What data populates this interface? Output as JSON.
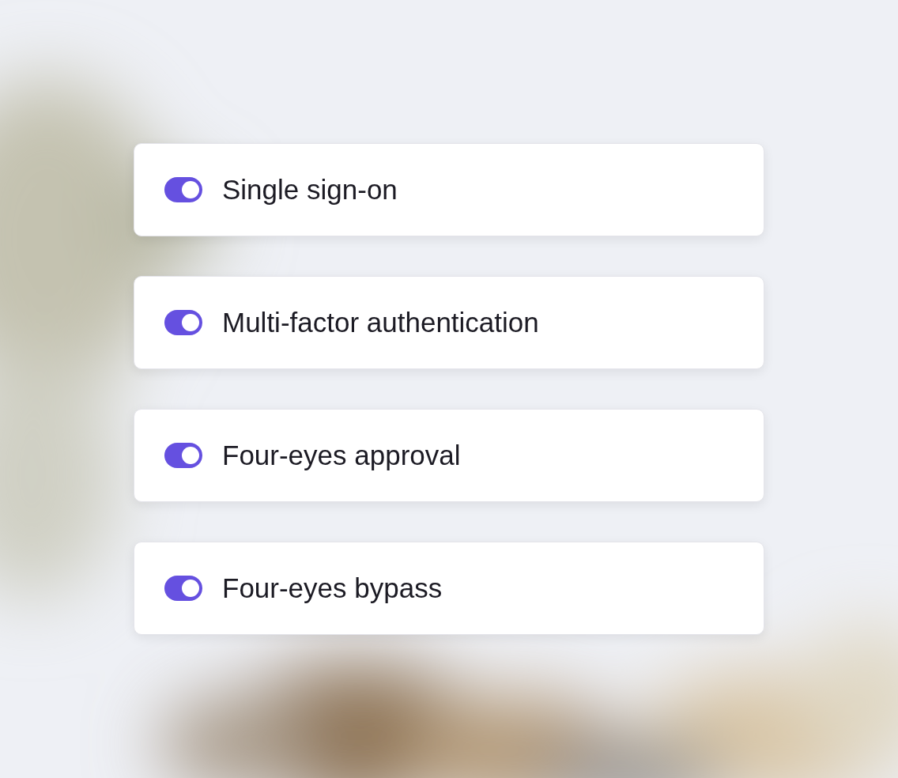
{
  "settings": [
    {
      "label": "Single sign-on",
      "on": true
    },
    {
      "label": "Multi-factor authentication",
      "on": true
    },
    {
      "label": "Four-eyes approval",
      "on": true
    },
    {
      "label": "Four-eyes bypass",
      "on": true
    }
  ]
}
